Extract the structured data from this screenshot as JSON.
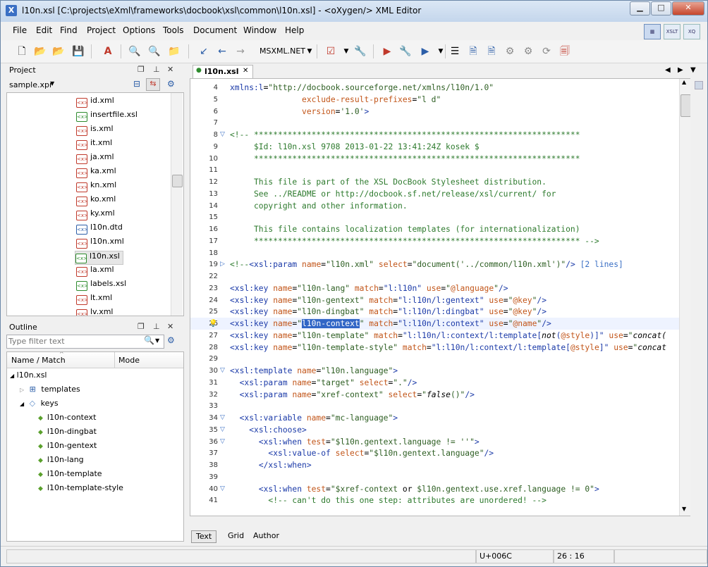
{
  "window": {
    "title": "l10n.xsl [C:\\projects\\eXml\\frameworks\\docbook\\xsl\\common\\l10n.xsl] - <oXygen/> XML Editor"
  },
  "menu": [
    "File",
    "Edit",
    "Find",
    "Project",
    "Options",
    "Tools",
    "Document",
    "Window",
    "Help"
  ],
  "toolbar": {
    "transformer": "MSXML.NET"
  },
  "project": {
    "title": "Project",
    "selector": "sample.xpr",
    "files": [
      {
        "name": "id.xml",
        "type": "xml"
      },
      {
        "name": "insertfile.xsl",
        "type": "xsl"
      },
      {
        "name": "is.xml",
        "type": "xml"
      },
      {
        "name": "it.xml",
        "type": "xml"
      },
      {
        "name": "ja.xml",
        "type": "xml"
      },
      {
        "name": "ka.xml",
        "type": "xml"
      },
      {
        "name": "kn.xml",
        "type": "xml"
      },
      {
        "name": "ko.xml",
        "type": "xml"
      },
      {
        "name": "ky.xml",
        "type": "xml"
      },
      {
        "name": "l10n.dtd",
        "type": "dtd"
      },
      {
        "name": "l10n.xml",
        "type": "xml"
      },
      {
        "name": "l10n.xsl",
        "type": "xsl",
        "selected": true
      },
      {
        "name": "la.xml",
        "type": "xml"
      },
      {
        "name": "labels.xsl",
        "type": "xsl"
      },
      {
        "name": "lt.xml",
        "type": "xml"
      },
      {
        "name": "lv.xml",
        "type": "xml"
      }
    ]
  },
  "outline": {
    "title": "Outline",
    "filter_placeholder": "Type filter text",
    "columns": [
      "Name / Match",
      "Mode"
    ],
    "root": "l10n.xsl",
    "templates": "templates",
    "keys": "keys",
    "key_items": [
      "l10n-context",
      "l10n-dingbat",
      "l10n-gentext",
      "l10n-lang",
      "l10n-template",
      "l10n-template-style"
    ]
  },
  "editor": {
    "tab": "l10n.xsl",
    "lines": [
      {
        "n": "4",
        "parts": [
          [
            "tag",
            "xmlns:l"
          ],
          [
            "txt",
            "="
          ],
          [
            "val",
            "\"http://docbook.sourceforge.net/xmlns/l10n/1.0\""
          ]
        ]
      },
      {
        "n": "5",
        "parts": [
          [
            "txt",
            "               "
          ],
          [
            "attr",
            "exclude-result-prefixes"
          ],
          [
            "txt",
            "="
          ],
          [
            "val",
            "\"l d\""
          ]
        ]
      },
      {
        "n": "6",
        "parts": [
          [
            "txt",
            "               "
          ],
          [
            "attr",
            "version"
          ],
          [
            "txt",
            "="
          ],
          [
            "val",
            "'1.0'"
          ],
          [
            "tag",
            ">"
          ]
        ]
      },
      {
        "n": "7",
        "parts": []
      },
      {
        "n": "8",
        "fold": "▽",
        "parts": [
          [
            "com",
            "<!-- ********************************************************************"
          ]
        ]
      },
      {
        "n": "9",
        "parts": [
          [
            "com",
            "     $Id: l10n.xsl 9708 2013-01-22 13:41:24Z kosek $"
          ]
        ]
      },
      {
        "n": "10",
        "parts": [
          [
            "com",
            "     ********************************************************************"
          ]
        ]
      },
      {
        "n": "11",
        "parts": []
      },
      {
        "n": "12",
        "parts": [
          [
            "com",
            "     This file is part of the XSL DocBook Stylesheet distribution."
          ]
        ]
      },
      {
        "n": "13",
        "parts": [
          [
            "com",
            "     See ../README or http://docbook.sf.net/release/xsl/current/ for"
          ]
        ]
      },
      {
        "n": "14",
        "parts": [
          [
            "com",
            "     copyright and other information."
          ]
        ]
      },
      {
        "n": "15",
        "parts": []
      },
      {
        "n": "16",
        "parts": [
          [
            "com",
            "     This file contains localization templates (for internationalization)"
          ]
        ]
      },
      {
        "n": "17",
        "parts": [
          [
            "com",
            "     ******************************************************************** -->"
          ]
        ]
      },
      {
        "n": "18",
        "parts": []
      },
      {
        "n": "19",
        "fold": "▷",
        "parts": [
          [
            "com",
            "<!--"
          ],
          [
            "tag",
            "<xsl:param "
          ],
          [
            "attr",
            "name"
          ],
          [
            "txt",
            "="
          ],
          [
            "val",
            "\"l10n.xml\" "
          ],
          [
            "attr",
            "select"
          ],
          [
            "txt",
            "="
          ],
          [
            "val",
            "\"document('../common/l10n.xml')\""
          ],
          [
            "tag",
            "/>"
          ],
          [
            "txt",
            " "
          ],
          [
            "fold",
            "[2 lines]"
          ]
        ]
      },
      {
        "n": "22",
        "parts": []
      },
      {
        "n": "23",
        "parts": [
          [
            "tag",
            "<xsl:key "
          ],
          [
            "attr",
            "name"
          ],
          [
            "txt",
            "="
          ],
          [
            "val",
            "\"l10n-lang\" "
          ],
          [
            "attr",
            "match"
          ],
          [
            "txt",
            "="
          ],
          [
            "tag",
            "\"l:l10n\" "
          ],
          [
            "attr",
            "use"
          ],
          [
            "txt",
            "="
          ],
          [
            "val",
            "\""
          ],
          [
            "attr",
            "@language"
          ],
          [
            "val",
            "\""
          ],
          [
            "tag",
            "/>"
          ]
        ]
      },
      {
        "n": "24",
        "parts": [
          [
            "tag",
            "<xsl:key "
          ],
          [
            "attr",
            "name"
          ],
          [
            "txt",
            "="
          ],
          [
            "val",
            "\"l10n-gentext\" "
          ],
          [
            "attr",
            "match"
          ],
          [
            "txt",
            "="
          ],
          [
            "tag",
            "\"l:l10n/l:gentext\" "
          ],
          [
            "attr",
            "use"
          ],
          [
            "txt",
            "="
          ],
          [
            "val",
            "\""
          ],
          [
            "attr",
            "@key"
          ],
          [
            "val",
            "\""
          ],
          [
            "tag",
            "/>"
          ]
        ]
      },
      {
        "n": "25",
        "parts": [
          [
            "tag",
            "<xsl:key "
          ],
          [
            "attr",
            "name"
          ],
          [
            "txt",
            "="
          ],
          [
            "val",
            "\"l10n-dingbat\" "
          ],
          [
            "attr",
            "match"
          ],
          [
            "txt",
            "="
          ],
          [
            "tag",
            "\"l:l10n/l:dingbat\" "
          ],
          [
            "attr",
            "use"
          ],
          [
            "txt",
            "="
          ],
          [
            "val",
            "\""
          ],
          [
            "attr",
            "@key"
          ],
          [
            "val",
            "\""
          ],
          [
            "tag",
            "/>"
          ]
        ]
      },
      {
        "n": "26",
        "hl": true,
        "bulb": true,
        "parts": [
          [
            "tag",
            "<xsl:key "
          ],
          [
            "attr",
            "name"
          ],
          [
            "txt",
            "="
          ],
          [
            "val",
            "\""
          ],
          [
            "sel",
            "l10n-context"
          ],
          [
            "val",
            "\" "
          ],
          [
            "attr",
            "match"
          ],
          [
            "txt",
            "="
          ],
          [
            "tag",
            "\"l:l10n/l:context\" "
          ],
          [
            "attr",
            "use"
          ],
          [
            "txt",
            "="
          ],
          [
            "val",
            "\""
          ],
          [
            "attr",
            "@name"
          ],
          [
            "val",
            "\""
          ],
          [
            "tag",
            "/>"
          ]
        ]
      },
      {
        "n": "27",
        "parts": [
          [
            "tag",
            "<xsl:key "
          ],
          [
            "attr",
            "name"
          ],
          [
            "txt",
            "="
          ],
          [
            "val",
            "\"l10n-template\" "
          ],
          [
            "attr",
            "match"
          ],
          [
            "txt",
            "="
          ],
          [
            "tag",
            "\"l:l10n/l:context/l:template["
          ],
          [
            "fn",
            "not"
          ],
          [
            "tag",
            "("
          ],
          [
            "attr",
            "@style"
          ],
          [
            "tag",
            ")]\" "
          ],
          [
            "attr",
            "use"
          ],
          [
            "txt",
            "="
          ],
          [
            "val",
            "\""
          ],
          [
            "fn",
            "concat("
          ]
        ]
      },
      {
        "n": "28",
        "parts": [
          [
            "tag",
            "<xsl:key "
          ],
          [
            "attr",
            "name"
          ],
          [
            "txt",
            "="
          ],
          [
            "val",
            "\"l10n-template-style\" "
          ],
          [
            "attr",
            "match"
          ],
          [
            "txt",
            "="
          ],
          [
            "tag",
            "\"l:l10n/l:context/l:template["
          ],
          [
            "attr",
            "@style"
          ],
          [
            "tag",
            "]\" "
          ],
          [
            "attr",
            "use"
          ],
          [
            "txt",
            "="
          ],
          [
            "val",
            "\""
          ],
          [
            "fn",
            "concat"
          ]
        ]
      },
      {
        "n": "29",
        "parts": []
      },
      {
        "n": "30",
        "fold": "▽",
        "parts": [
          [
            "tag",
            "<xsl:template "
          ],
          [
            "attr",
            "name"
          ],
          [
            "txt",
            "="
          ],
          [
            "val",
            "\"l10n.language\""
          ],
          [
            "tag",
            ">"
          ]
        ]
      },
      {
        "n": "31",
        "parts": [
          [
            "txt",
            "  "
          ],
          [
            "tag",
            "<xsl:param "
          ],
          [
            "attr",
            "name"
          ],
          [
            "txt",
            "="
          ],
          [
            "val",
            "\"target\" "
          ],
          [
            "attr",
            "select"
          ],
          [
            "txt",
            "="
          ],
          [
            "val",
            "\".\""
          ],
          [
            "tag",
            "/>"
          ]
        ]
      },
      {
        "n": "32",
        "parts": [
          [
            "txt",
            "  "
          ],
          [
            "tag",
            "<xsl:param "
          ],
          [
            "attr",
            "name"
          ],
          [
            "txt",
            "="
          ],
          [
            "val",
            "\"xref-context\" "
          ],
          [
            "attr",
            "select"
          ],
          [
            "txt",
            "="
          ],
          [
            "val",
            "\""
          ],
          [
            "fn",
            "false"
          ],
          [
            "val",
            "()\""
          ],
          [
            "tag",
            "/>"
          ]
        ]
      },
      {
        "n": "33",
        "parts": []
      },
      {
        "n": "34",
        "fold": "▽",
        "parts": [
          [
            "txt",
            "  "
          ],
          [
            "tag",
            "<xsl:variable "
          ],
          [
            "attr",
            "name"
          ],
          [
            "txt",
            "="
          ],
          [
            "val",
            "\"mc-language\""
          ],
          [
            "tag",
            ">"
          ]
        ]
      },
      {
        "n": "35",
        "fold": "▽",
        "parts": [
          [
            "txt",
            "    "
          ],
          [
            "tag",
            "<xsl:choose>"
          ]
        ]
      },
      {
        "n": "36",
        "fold": "▽",
        "parts": [
          [
            "txt",
            "      "
          ],
          [
            "tag",
            "<xsl:when "
          ],
          [
            "attr",
            "test"
          ],
          [
            "txt",
            "="
          ],
          [
            "val",
            "\"$l10n.gentext.language != ''\""
          ],
          [
            "tag",
            ">"
          ]
        ]
      },
      {
        "n": "37",
        "parts": [
          [
            "txt",
            "        "
          ],
          [
            "tag",
            "<xsl:value-of "
          ],
          [
            "attr",
            "select"
          ],
          [
            "txt",
            "="
          ],
          [
            "val",
            "\"$l10n.gentext.language\""
          ],
          [
            "tag",
            "/>"
          ]
        ]
      },
      {
        "n": "38",
        "parts": [
          [
            "txt",
            "      "
          ],
          [
            "tag",
            "</xsl:when>"
          ]
        ]
      },
      {
        "n": "39",
        "parts": []
      },
      {
        "n": "40",
        "fold": "▽",
        "parts": [
          [
            "txt",
            "      "
          ],
          [
            "tag",
            "<xsl:when "
          ],
          [
            "attr",
            "test"
          ],
          [
            "txt",
            "="
          ],
          [
            "val",
            "\"$xref-context "
          ],
          [
            "txt",
            "or "
          ],
          [
            "val",
            "$l10n.gentext.use.xref.language != 0\""
          ],
          [
            "tag",
            ">"
          ]
        ]
      },
      {
        "n": "41",
        "parts": [
          [
            "txt",
            "        "
          ],
          [
            "com",
            "<!-- can't do this one step: attributes are unordered! -->"
          ]
        ]
      }
    ]
  },
  "modes": [
    "Text",
    "Grid",
    "Author"
  ],
  "status": {
    "unicode": "U+006C",
    "position": "26 : 16"
  }
}
